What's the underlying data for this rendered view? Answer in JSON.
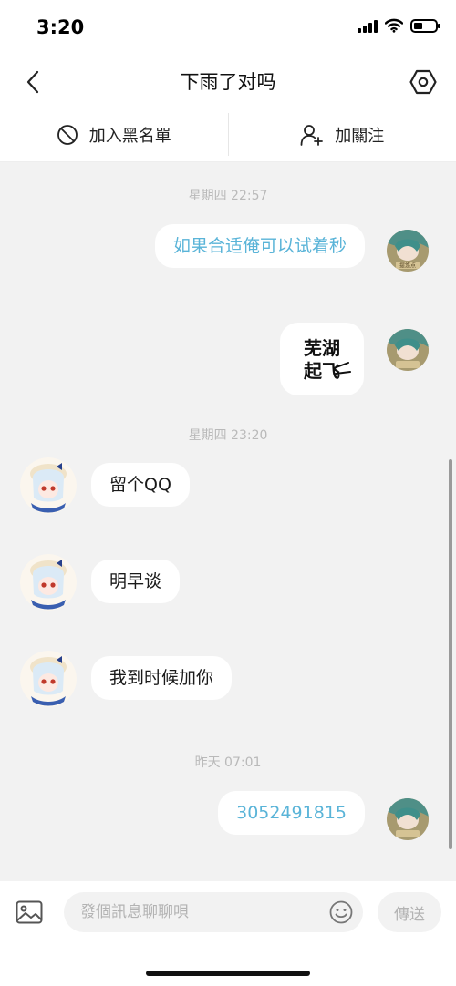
{
  "status_bar": {
    "time": "3:20"
  },
  "header": {
    "title": "下雨了对吗"
  },
  "actions": {
    "block_label": "加入黑名單",
    "follow_label": "加關注"
  },
  "chat": {
    "timestamps": [
      "星期四 22:57",
      "星期四 23:20",
      "昨天 07:01"
    ],
    "messages": [
      {
        "sender": "me",
        "text": "如果合适俺可以试着秒"
      },
      {
        "sender": "me",
        "type": "sticker",
        "sticker_text": [
          "芜湖",
          "起飞"
        ]
      },
      {
        "sender": "other",
        "text": "留个QQ"
      },
      {
        "sender": "other",
        "text": "明早谈"
      },
      {
        "sender": "other",
        "text": "我到时候加你"
      },
      {
        "sender": "me",
        "text": "3052491815"
      }
    ],
    "my_avatar_badge": "提悠点"
  },
  "input": {
    "placeholder": "發個訊息聊聊唄",
    "send_label": "傳送"
  },
  "colors": {
    "my_text": "#5ab4d8",
    "chat_bg": "#f2f2f2",
    "timestamp": "#b9b9b9"
  }
}
